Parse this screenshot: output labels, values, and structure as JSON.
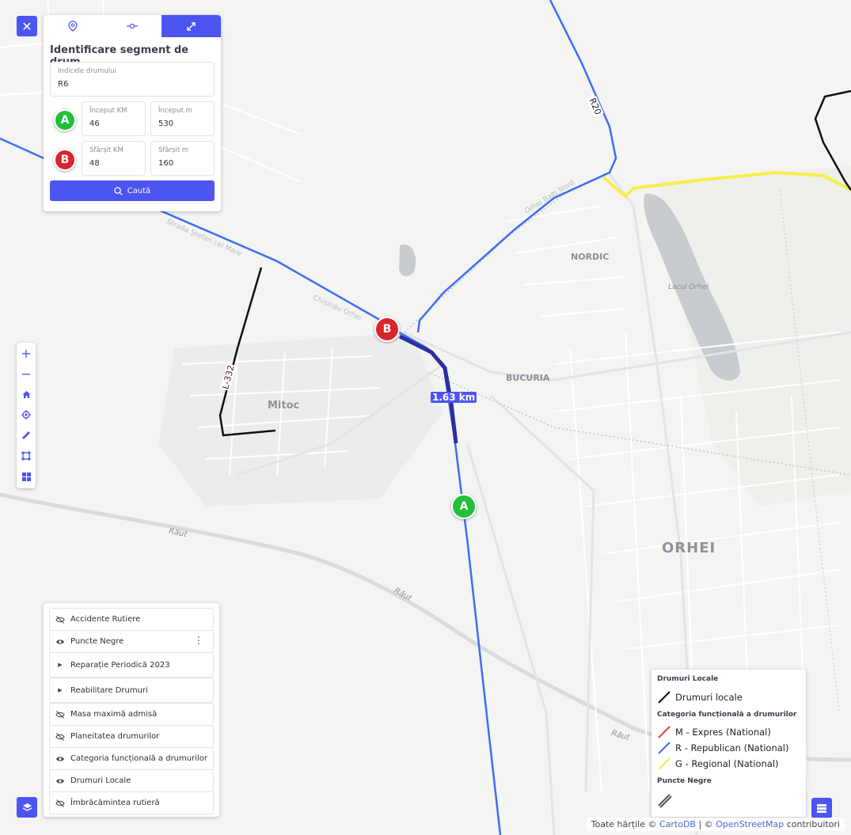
{
  "close_label": "✕",
  "tabs": [
    {
      "name": "location-pin-icon"
    },
    {
      "name": "segment-point-icon"
    },
    {
      "name": "expand-segment-icon",
      "active": true
    }
  ],
  "search": {
    "title": "Identificare segment de drum",
    "road_index_label": "Indicele drumului",
    "road_index_value": "R6",
    "start_badge": "A",
    "end_badge": "B",
    "start_km_label": "Început KM",
    "start_km_value": "46",
    "start_m_label": "Început m",
    "start_m_value": "530",
    "end_km_label": "Sfârșit KM",
    "end_km_value": "48",
    "end_m_label": "Sfârșit m",
    "end_m_value": "160",
    "button_label": "Caută"
  },
  "tools": [
    "+",
    "−",
    "home-icon",
    "locate-icon",
    "ruler-icon",
    "draw-polygon-icon",
    "grid-icon"
  ],
  "layers": [
    {
      "icon": "eye-off-icon",
      "label": "Accidente Rutiere"
    },
    {
      "icon": "eye-icon",
      "label": "Puncte Negre",
      "menu": true
    },
    {
      "icon": "caret-right-icon",
      "label": "Reparație Periodică 2023"
    },
    {
      "icon": "caret-right-icon",
      "label": "Reabilitare Drumuri"
    },
    {
      "icon": "eye-off-icon",
      "label": "Masa maximă admisă"
    },
    {
      "icon": "eye-off-icon",
      "label": "Planeitatea drumurilor"
    },
    {
      "icon": "eye-icon",
      "label": "Categoria funcțională a drumurilor"
    },
    {
      "icon": "eye-icon",
      "label": "Drumuri Locale"
    },
    {
      "icon": "eye-off-icon",
      "label": "Îmbrăcămintea rutieră"
    }
  ],
  "legend": {
    "group1": "Drumuri Locale",
    "item_local": "Drumuri locale",
    "group2": "Categoria funcțională a drumurilor",
    "item_m": "M - Expres (National)",
    "item_r": "R - Republican (National)",
    "item_g": "G - Regional (National)",
    "group3": "Puncte Negre",
    "colors": {
      "local": "#111111",
      "m": "#e8412c",
      "r": "#3b6ff2",
      "g": "#f5ef4a"
    }
  },
  "map": {
    "labels": {
      "orhei": "ORHEI",
      "nordic": "NORDIC",
      "bucuria": "BUCURIA",
      "mitoc": "Mitoc",
      "lake": "Lacul Orhei",
      "river1": "Răut",
      "river2": "Răut",
      "river3": "Răut",
      "road_r20": "R20",
      "road_l332": "L-332"
    },
    "distance": "1.63 km",
    "marker_a": "A",
    "marker_b": "B"
  },
  "attribution": {
    "prefix": "Toate hărțile ©",
    "cartodb": "CartoDB",
    "sep": "| ©",
    "osm": "OpenStreetMap",
    "suffix": "contribuitori"
  },
  "colors": {
    "accent": "#4c55f0",
    "marker_a": "#22c03a",
    "marker_b": "#d9262c"
  }
}
